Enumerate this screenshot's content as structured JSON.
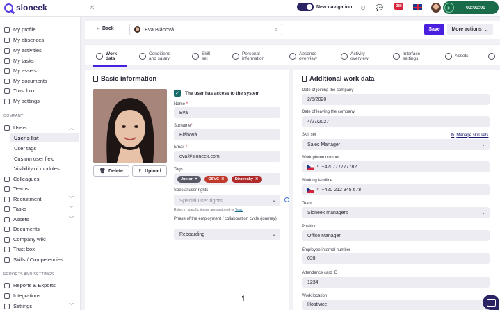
{
  "app": {
    "brand": "sloneek"
  },
  "topbar": {
    "new_navigation_label": "New navigation",
    "notifications_badge": "280",
    "timer": "00:00:00"
  },
  "sidebar": {
    "personal": [
      "My profile",
      "My absences",
      "My activities",
      "My tasks",
      "My assets",
      "My documents",
      "Trust box",
      "My settings"
    ],
    "company_section": "COMPANY",
    "users_label": "Users",
    "users_children": [
      "User's list",
      "User tags",
      "Custom user field",
      "Visibility of modules"
    ],
    "company_items": [
      "Colleagues",
      "Teams",
      "Recruitment",
      "Tasks",
      "Assets",
      "Documents",
      "Company wiki",
      "Trust box",
      "Skills / Competencies"
    ],
    "reports_section": "REPORTS AND SETTINGS",
    "reports_items": [
      "Reports & Exports",
      "Integrations",
      "Settings"
    ]
  },
  "header": {
    "back_label": "Back",
    "employee_name": "Eva Bláhová",
    "save_label": "Save",
    "more_actions_label": "More actions"
  },
  "tabs": [
    {
      "label": "Work data",
      "icon": "briefcase-icon"
    },
    {
      "label": "Conditions and salary",
      "icon": "list-icon"
    },
    {
      "label": "Skill set",
      "icon": "skill-icon"
    },
    {
      "label": "Personal information",
      "icon": "info-icon"
    },
    {
      "label": "Absence overview",
      "icon": "calendar-icon"
    },
    {
      "label": "Activity overview",
      "icon": "activity-icon"
    },
    {
      "label": "Interface settings",
      "icon": "settings-icon"
    },
    {
      "label": "Assets",
      "icon": "assets-icon"
    }
  ],
  "basic": {
    "title": "Basic information",
    "delete_label": "Delete",
    "upload_label": "Upload",
    "access_label": "The user has access to the system",
    "name_label": "Name",
    "name_value": "Eva",
    "surname_label": "Surname",
    "surname_value": "Bláhová",
    "email_label": "Email",
    "email_value": "eva@sloneek.com",
    "tags_label": "Tags",
    "tags": [
      {
        "label": "Junior",
        "color": "#5a5a66"
      },
      {
        "label": "OSVČ",
        "color": "#c0392b"
      },
      {
        "label": "Stravenky",
        "color": "#b02a2a"
      }
    ],
    "rights_label": "Special user rights",
    "rights_placeholder": "Special user rights",
    "rights_note": "Roles in specific teams are assigned in",
    "rights_note_link": "Team",
    "phase_label": "Phase of the employment / collaboration cycle (journey)",
    "phase_value": "Reboarding"
  },
  "additional": {
    "title": "Additional work data",
    "join_label": "Date of joining the company",
    "join_value": "2/5/2020",
    "leave_label": "Date of leaving the company",
    "leave_value": "4/27/2027",
    "skill_label": "Skill set",
    "manage_skill_label": "Manage skill sets",
    "skill_value": "Sales Manager",
    "work_phone_label": "Work phone number",
    "work_phone_value": "+420777777782",
    "landline_label": "Working landline",
    "landline_value": "+420 212 345 678",
    "team_label": "Team",
    "team_value": "Sloneek managers",
    "position_label": "Position",
    "position_value": "Office Manager",
    "internal_label": "Employee internal number",
    "internal_value": "028",
    "card_label": "Attendance card ID",
    "card_value": "1234",
    "location_label": "Work location",
    "location_value": "Hostivice"
  },
  "colors": {
    "accent": "#4a20e0",
    "brand": "#2d2266",
    "timer": "#1a6b4a"
  }
}
